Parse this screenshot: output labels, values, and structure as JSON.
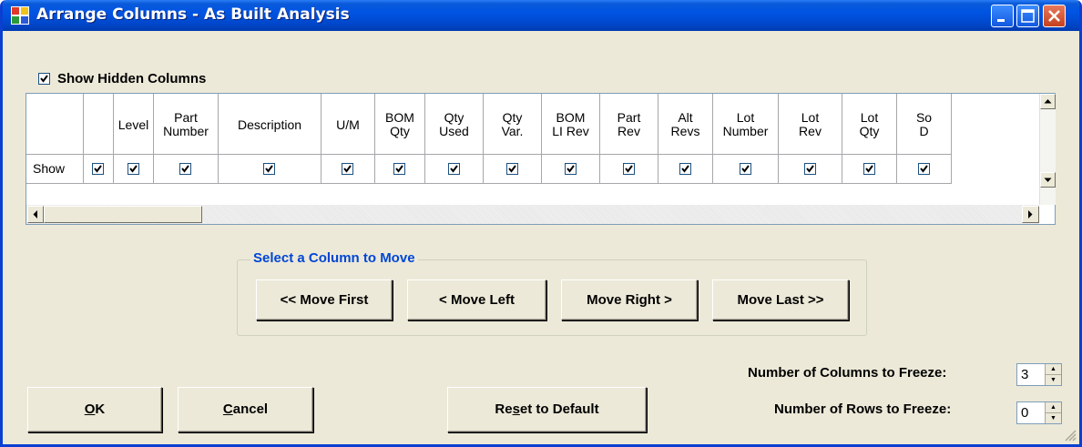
{
  "window": {
    "title": "Arrange Columns - As Built Analysis"
  },
  "show_hidden": {
    "label": "Show Hidden Columns",
    "checked": true
  },
  "grid": {
    "row_header": "Show",
    "columns": [
      {
        "label": "",
        "checked": true
      },
      {
        "label": "Level",
        "checked": true
      },
      {
        "label": "Part Number",
        "checked": true
      },
      {
        "label": "Description",
        "checked": true
      },
      {
        "label": "U/M",
        "checked": true
      },
      {
        "label": "BOM\nQty",
        "checked": true
      },
      {
        "label": "Qty\nUsed",
        "checked": true
      },
      {
        "label": "Qty\nVar.",
        "checked": true
      },
      {
        "label": "BOM\nLI Rev",
        "checked": true
      },
      {
        "label": "Part\nRev",
        "checked": true
      },
      {
        "label": "Alt\nRevs",
        "checked": true
      },
      {
        "label": "Lot\nNumber",
        "checked": true
      },
      {
        "label": "Lot\nRev",
        "checked": true
      },
      {
        "label": "Lot\nQty",
        "checked": true
      },
      {
        "label": "So\nD",
        "checked": true
      }
    ]
  },
  "move_group": {
    "title": "Select a Column to Move",
    "move_first": "<< Move First",
    "move_left": "< Move Left",
    "move_right": "Move Right >",
    "move_last": "Move Last >>"
  },
  "freeze": {
    "columns_label": "Number of Columns to Freeze:",
    "columns_value": "3",
    "rows_label": "Number of Rows to Freeze:",
    "rows_value": "0"
  },
  "buttons": {
    "ok": "OK",
    "cancel": "Cancel",
    "reset": "Reset to Default"
  }
}
